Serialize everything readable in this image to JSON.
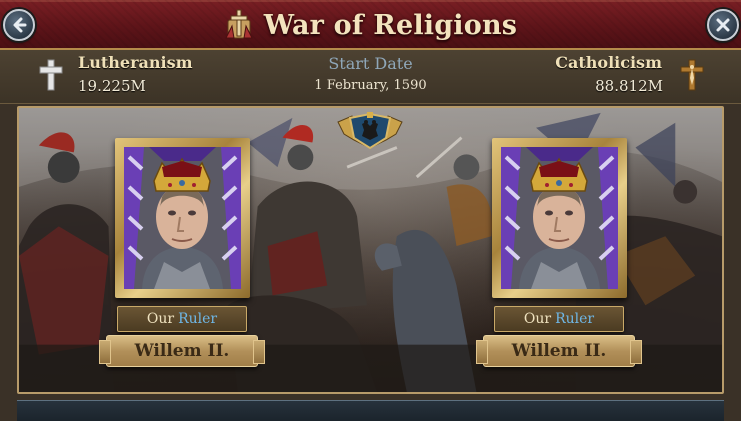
{
  "header": {
    "title": "War of Religions",
    "back_icon": "back-arrow-icon",
    "close_icon": "close-icon",
    "title_icon": "religion-war-icon"
  },
  "info": {
    "left": {
      "name": "Lutheranism",
      "count": "19.225M",
      "icon": "cross-icon"
    },
    "center": {
      "label": "Start Date",
      "date": "1 February, 1590"
    },
    "right": {
      "name": "Catholicism",
      "count": "88.812M",
      "icon": "crucifix-icon"
    }
  },
  "battle": {
    "emblem_icon": "double-headed-eagle-emblem",
    "left_ruler": {
      "prefix": "Our",
      "role": "Ruler",
      "name": "Willem II."
    },
    "right_ruler": {
      "prefix": "Our",
      "role": "Ruler",
      "name": "Willem II."
    }
  },
  "colors": {
    "title_bar": "#5e1419",
    "title_text": "#f3e3bd",
    "ruler_highlight": "#6fb7e6",
    "start_label": "#8fa7b9",
    "frame_gold": "#c9a968",
    "banner_purple": "#6a3fb5"
  }
}
